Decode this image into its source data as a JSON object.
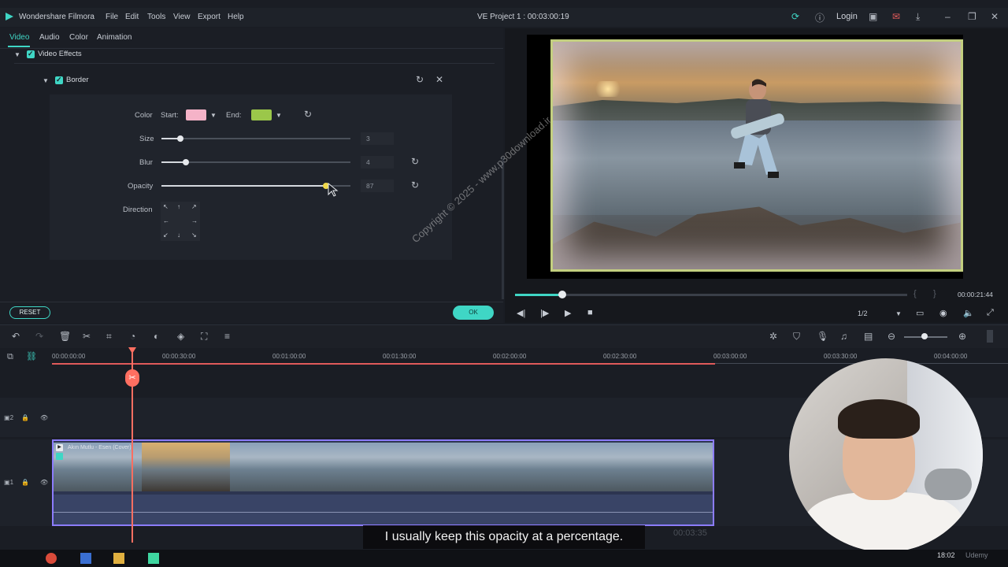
{
  "app": {
    "name": "Wondershare Filmora",
    "project_title": "VE Project 1 : 00:03:00:19",
    "menu": [
      "File",
      "Edit",
      "Tools",
      "View",
      "Export",
      "Help"
    ],
    "login_label": "Login"
  },
  "panel": {
    "tabs": [
      "Video",
      "Audio",
      "Color",
      "Animation"
    ],
    "active_tab": "Video",
    "section_label": "Video Effects",
    "effect_label": "Border",
    "color": {
      "label": "Color",
      "start_label": "Start:",
      "start_color": "#f5b3c8",
      "end_label": "End:",
      "end_color": "#9bc74a"
    },
    "sliders": [
      {
        "label": "Size",
        "value": "3",
        "fraction": 0.1
      },
      {
        "label": "Blur",
        "value": "4",
        "fraction": 0.13
      },
      {
        "label": "Opacity",
        "value": "87",
        "fraction": 0.87
      }
    ],
    "direction_label": "Direction",
    "reset_label": "RESET",
    "ok_label": "OK"
  },
  "preview": {
    "time": "00:00:21:44",
    "progress_fraction": 0.12,
    "quality": "1/2"
  },
  "timeline": {
    "ruler": [
      "00:00:00:00",
      "00:00:30:00",
      "00:01:00:00",
      "00:01:30:00",
      "00:02:00:00",
      "00:02:30:00",
      "00:03:00:00",
      "00:03:30:00",
      "00:04:00:00"
    ],
    "track_top_label": "2",
    "track_bottom_label": "1",
    "clip_title": "Akın Mutlu - Esen (Cover)"
  },
  "overlay": {
    "subtitle": "I usually keep this opacity at a percentage.",
    "watermark": "Copyright © 2025 - www.p30download.ir",
    "ghost_time": "00:03:35",
    "clock": "18:02",
    "brand": "Udemy"
  },
  "colors": {
    "accent": "#3fd6c5",
    "playhead": "#ff6f61",
    "clip_border": "#8c7cff",
    "video_border": "#c3cf7f"
  }
}
